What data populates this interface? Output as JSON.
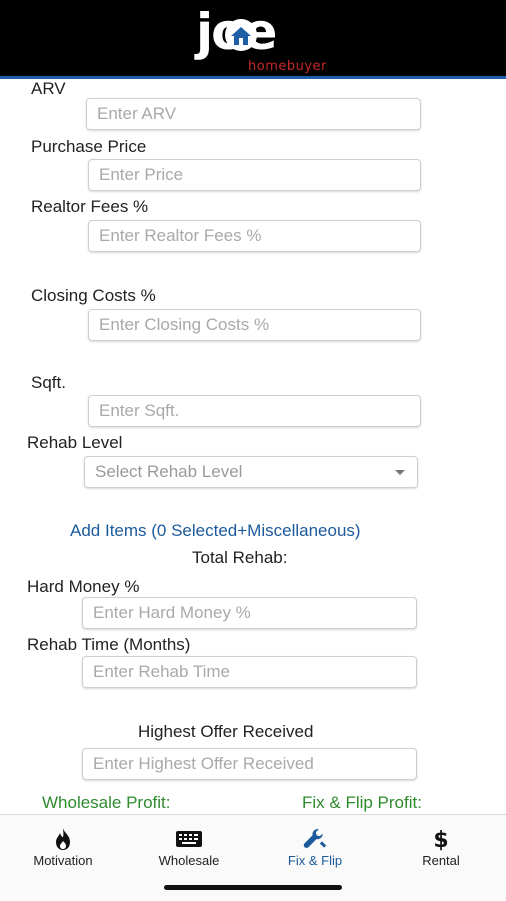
{
  "brand": {
    "logo_word": "joe",
    "logo_sub": "homebuyer"
  },
  "form": {
    "arv": {
      "label": "ARV",
      "placeholder": "Enter ARV"
    },
    "purchase_price": {
      "label": "Purchase Price",
      "placeholder": "Enter Price"
    },
    "realtor_fees": {
      "label": "Realtor Fees %",
      "placeholder": "Enter Realtor Fees %"
    },
    "closing_costs": {
      "label": "Closing Costs %",
      "placeholder": "Enter Closing Costs %"
    },
    "sqft": {
      "label": "Sqft.",
      "placeholder": "Enter Sqft."
    },
    "rehab_level": {
      "label": "Rehab Level",
      "placeholder": "Select Rehab Level"
    },
    "add_items": "Add Items (0  Selected+Miscellaneous)",
    "total_rehab": "Total Rehab:",
    "hard_money": {
      "label": "Hard Money %",
      "placeholder": "Enter Hard Money %"
    },
    "rehab_time": {
      "label": "Rehab Time (Months)",
      "placeholder": "Enter Rehab Time"
    },
    "highest_offer": {
      "label": "Highest Offer Received",
      "placeholder": "Enter Highest Offer Received"
    },
    "wholesale_profit": "Wholesale Profit:",
    "fix_flip_profit": "Fix & Flip Profit:"
  },
  "tabs": [
    {
      "label": "Motivation",
      "icon": "fire-icon"
    },
    {
      "label": "Wholesale",
      "icon": "keyboard-icon"
    },
    {
      "label": "Fix & Flip",
      "icon": "wrench-icon",
      "active": true
    },
    {
      "label": "Rental",
      "icon": "dollar-icon"
    }
  ],
  "colors": {
    "accent": "#1c5a9c",
    "profit_green": "#2e8b2e",
    "header_bg": "#000000",
    "logo_red": "#c62828"
  }
}
